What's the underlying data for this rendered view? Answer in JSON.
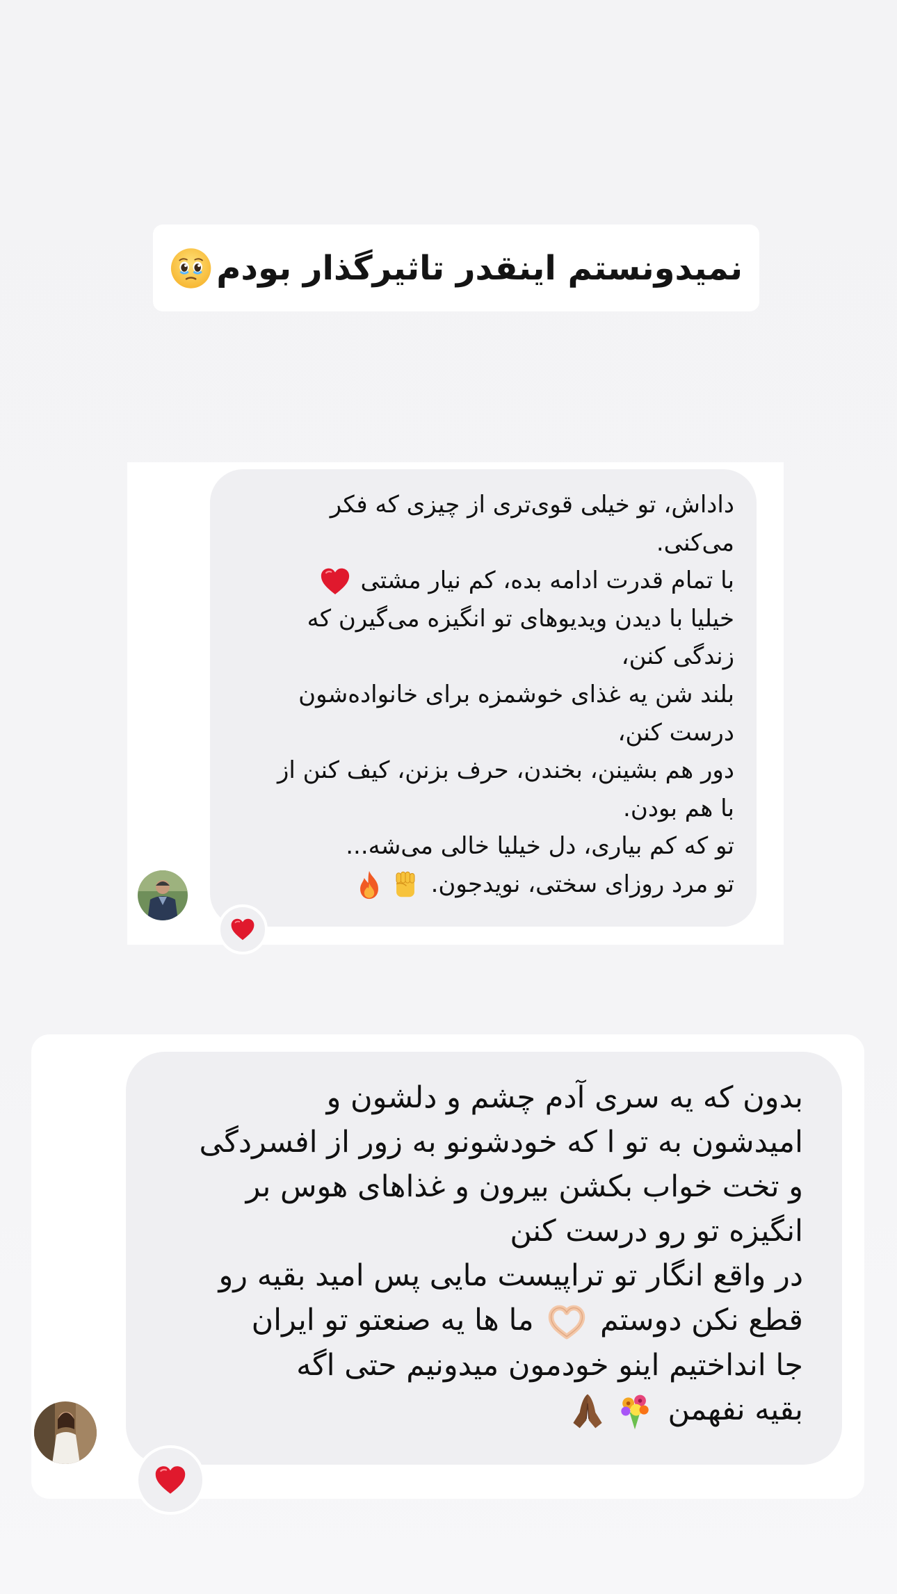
{
  "caption": {
    "text": "نمیدونستم اینقدر تاثیرگذار بودم",
    "emoji": "face-holding-back-tears-icon"
  },
  "messages": [
    {
      "lines": [
        "داداش، تو خیلی قوی‌تری از چیزی که فکر",
        "می‌کنی.",
        "با تمام قدرت ادامه بده، کم نیار مشتی",
        "خیلیا با دیدن ویدیوهای تو انگیزه می‌گیرن که",
        "زندگی کنن،",
        "بلند شن یه غذای خوشمزه برای خانواده‌شون",
        "درست کنن،",
        "دور هم بشینن، بخندن، حرف بزنن، کیف کنن از",
        "با هم بودن.",
        "تو که کم بیاری، دل خیلیا خالی می‌شه...",
        "تو مرد روزای سختی، نویدجون."
      ],
      "line_emojis": {
        "2": [
          "red-heart-icon"
        ],
        "10": [
          "raised-fist-icon",
          "fire-icon"
        ]
      },
      "reaction": "red-heart-icon",
      "avatar": "avatar-man-in-vest"
    },
    {
      "lines": [
        "بدون که یه سری آدم چشم و دلشون و",
        "امیدشون به تو ا که خودشونو به زور از افسردگی",
        "و تخت خواب بکشن بیرون و غذاهای هوس بر",
        "انگیزه تو رو درست کنن",
        "در واقع انگار تو تراپیست مایی پس امید بقیه رو",
        "قطع نکن دوستم",
        "ما ها یه صنعتو تو ایران",
        "جا انداختیم اینو خودمون میدونیم حتی اگه",
        "بقیه نفهمن"
      ],
      "line_emojis": {
        "5": [
          "heart-hands-icon"
        ],
        "8": [
          "bouquet-icon",
          "folded-hands-icon"
        ]
      },
      "reaction": "red-heart-icon",
      "avatar": "avatar-woman-white-dress"
    }
  ],
  "colors": {
    "background": "#f4f4f6",
    "card": "#ffffff",
    "bubble": "#efeff2",
    "heart": "#e0192d",
    "text": "#111111"
  }
}
